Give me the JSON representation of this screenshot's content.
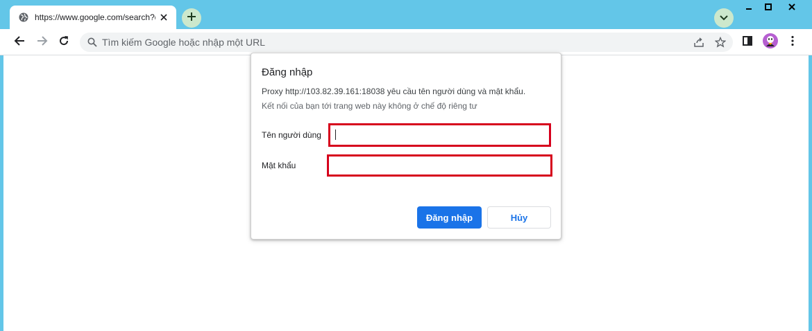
{
  "tab": {
    "title": "https://www.google.com/search?q=",
    "favicon_icon": "globe-icon",
    "close_icon": "close-icon"
  },
  "tabstrip": {
    "new_tab_icon": "plus-icon",
    "tab_search_icon": "chevron-down-icon"
  },
  "window_controls": {
    "minimize_icon": "minimize-icon",
    "maximize_icon": "maximize-icon",
    "close_icon": "close-icon"
  },
  "toolbar": {
    "back_icon": "arrow-left-icon",
    "forward_icon": "arrow-right-icon",
    "reload_icon": "reload-icon",
    "omnibox_placeholder": "Tìm kiếm Google hoặc nhập một URL",
    "omnibox_value": "",
    "share_icon": "share-icon",
    "bookmark_icon": "star-icon",
    "side_panel_icon": "side-panel-icon",
    "profile_icon": "avatar",
    "menu_icon": "kebab-menu-icon"
  },
  "dialog": {
    "title": "Đăng nhập",
    "message": "Proxy http://103.82.39.161:18038 yêu cầu tên người dùng và mật khẩu.",
    "note": "Kết nối của bạn tới trang web này không ở chế độ riêng tư",
    "username_label": "Tên người dùng",
    "username_value": "",
    "password_label": "Mật khẩu",
    "password_value": "",
    "login_label": "Đăng nhập",
    "cancel_label": "Hủy"
  },
  "colors": {
    "frame": "#63c6e8",
    "accent": "#1a73e8",
    "highlight_border": "#d6001c",
    "button_bubble": "#cce8cc"
  }
}
